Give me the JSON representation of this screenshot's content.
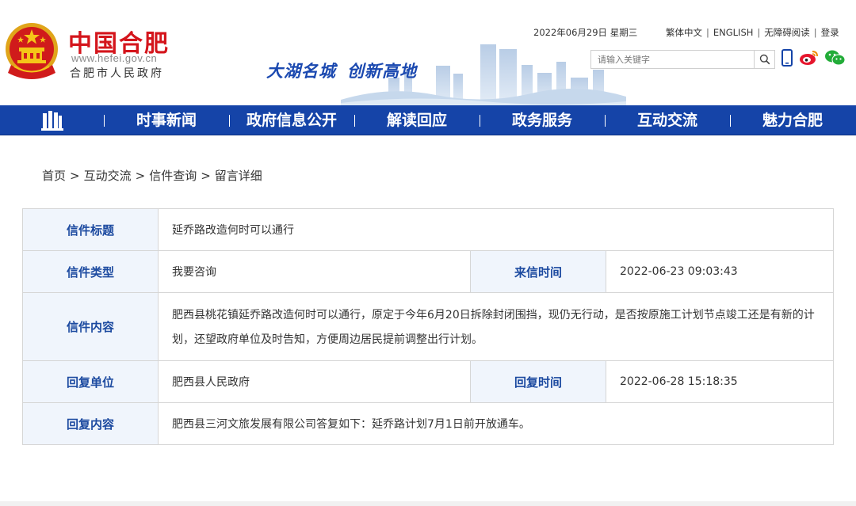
{
  "header": {
    "site_name": "中国合肥",
    "site_url": "www.hefei.gov.cn",
    "site_sub": "合肥市人民政府",
    "slogan_1": "大湖名城",
    "slogan_2": "创新高地",
    "date": "2022年06月29日 星期三",
    "links": [
      "繁体中文",
      "ENGLISH",
      "无障碍阅读",
      "登录"
    ],
    "search_placeholder": "请输入关键字",
    "icons": [
      "search-icon",
      "mobile-icon",
      "weibo-icon",
      "wechat-icon"
    ],
    "colors": {
      "brand_red": "#d4151c",
      "nav_blue": "#1544a8",
      "label_blue": "#1c4aa0",
      "label_bg": "#f0f5fc"
    }
  },
  "nav": {
    "items": [
      "时事新闻",
      "政府信息公开",
      "解读回应",
      "政务服务",
      "互动交流",
      "魅力合肥"
    ]
  },
  "breadcrumb": {
    "items": [
      "首页",
      "互动交流",
      "信件查询",
      "留言详细"
    ]
  },
  "letter": {
    "title_label": "信件标题",
    "title": "延乔路改造何时可以通行",
    "type_label": "信件类型",
    "type": "我要咨询",
    "time_label": "来信时间",
    "time": "2022-06-23 09:03:43",
    "content_label": "信件内容",
    "content": "肥西县桃花镇延乔路改造何时可以通行，原定于今年6月20日拆除封闭围挡，现仍无行动，是否按原施工计划节点竣工还是有新的计划，还望政府单位及时告知，方便周边居民提前调整出行计划。",
    "reply_unit_label": "回复单位",
    "reply_unit": "肥西县人民政府",
    "reply_time_label": "回复时间",
    "reply_time": "2022-06-28 15:18:35",
    "reply_content_label": "回复内容",
    "reply_content": "肥西县三河文旅发展有限公司答复如下：延乔路计划7月1日前开放通车。"
  }
}
